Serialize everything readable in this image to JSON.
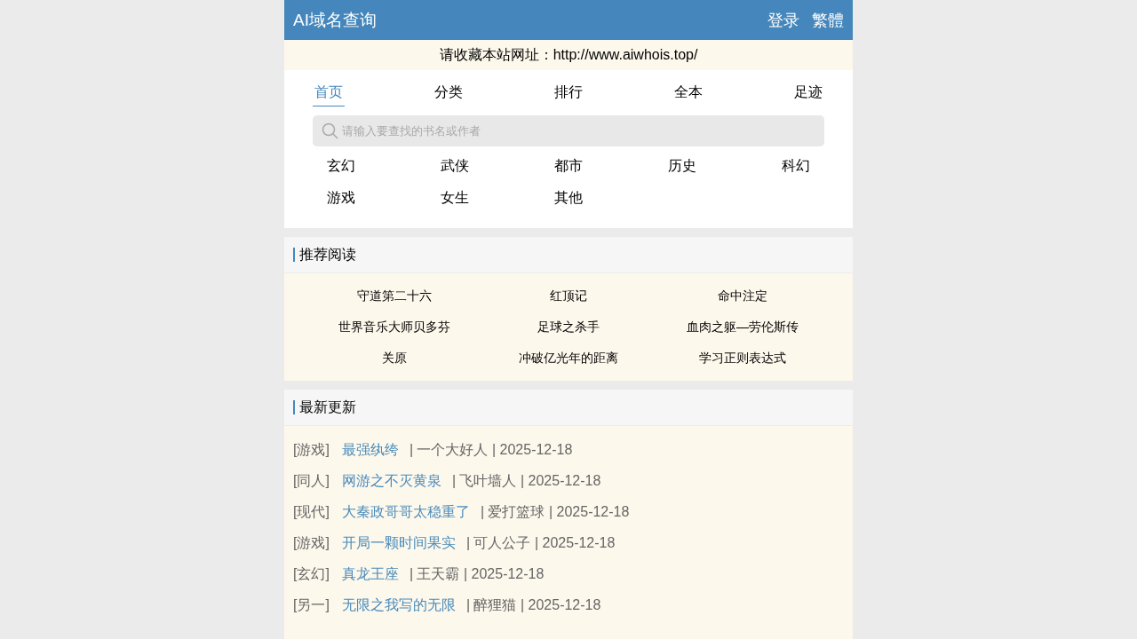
{
  "header": {
    "title": "AI域名查询",
    "links": [
      "登录",
      "繁體"
    ]
  },
  "notice": "请收藏本站网址：http://www.aiwhois.top/",
  "nav": [
    {
      "label": "首页",
      "selected": true
    },
    {
      "label": "分类",
      "selected": false
    },
    {
      "label": "排行",
      "selected": false
    },
    {
      "label": "全本",
      "selected": false
    },
    {
      "label": "足迹",
      "selected": false
    }
  ],
  "search": {
    "placeholder": "请输入要查找的书名或作者"
  },
  "categories": [
    "玄幻",
    "武侠",
    "都市",
    "历史",
    "科幻",
    "游戏",
    "女生",
    "其他"
  ],
  "recommended": {
    "title": "推荐阅读",
    "items": [
      "守道第二十六",
      "红顶记",
      "命中注定",
      "世界音乐大师贝多芬",
      "足球之杀手",
      "血肉之躯—劳伦斯传",
      "关原",
      "冲破亿光年的距离",
      "学习正则表达式"
    ]
  },
  "latest": {
    "title": "最新更新",
    "rows": [
      {
        "category": "[游戏]",
        "title": "最强纨绔",
        "meta": "| 一个大好人 | 2025-12-18"
      },
      {
        "category": "[同人]",
        "title": "网游之不灭黄泉",
        "meta": "| 飞叶墙人 | 2025-12-18"
      },
      {
        "category": "[现代]",
        "title": "大秦政哥哥太稳重了",
        "meta": "| 爱打篮球 | 2025-12-18"
      },
      {
        "category": "[游戏]",
        "title": "开局一颗时间果实",
        "meta": "| 可人公子 | 2025-12-18"
      },
      {
        "category": "[玄幻]",
        "title": "真龙王座",
        "meta": "| 王天霸 | 2025-12-18"
      },
      {
        "category": "[另一]",
        "title": "无限之我写的无限",
        "meta": "| 醉狸猫 | 2025-12-18"
      }
    ]
  }
}
